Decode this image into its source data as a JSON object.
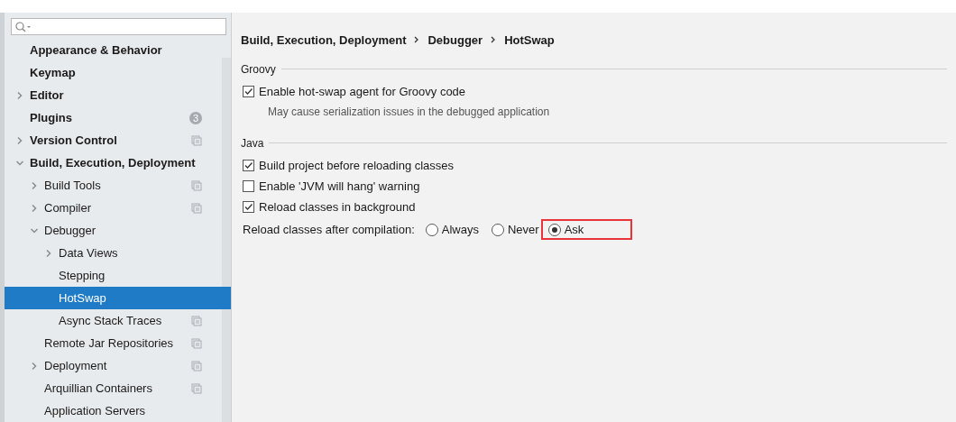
{
  "sidebar": {
    "items": [
      {
        "label": "Appearance & Behavior",
        "selected": false
      },
      {
        "label": "Keymap",
        "selected": false
      },
      {
        "label": "Editor",
        "expanded": false,
        "selected": false
      },
      {
        "label": "Plugins",
        "selected": false,
        "badge": "3"
      },
      {
        "label": "Version Control",
        "expanded": false,
        "selected": false,
        "project_icon": true
      },
      {
        "label": "Build, Execution, Deployment",
        "expanded": true,
        "selected": false,
        "children": [
          {
            "label": "Build Tools",
            "expanded": false,
            "selected": false,
            "project_icon": true
          },
          {
            "label": "Compiler",
            "expanded": false,
            "selected": false,
            "project_icon": true
          },
          {
            "label": "Debugger",
            "expanded": true,
            "selected": false,
            "children": [
              {
                "label": "Data Views",
                "expanded": false,
                "selected": false
              },
              {
                "label": "Stepping",
                "selected": false
              },
              {
                "label": "HotSwap",
                "selected": true
              },
              {
                "label": "Async Stack Traces",
                "selected": false,
                "project_icon": true
              }
            ]
          },
          {
            "label": "Remote Jar Repositories",
            "selected": false,
            "project_icon": true
          },
          {
            "label": "Deployment",
            "expanded": false,
            "selected": false,
            "project_icon": true
          },
          {
            "label": "Arquillian Containers",
            "selected": false,
            "project_icon": true
          },
          {
            "label": "Application Servers",
            "selected": false
          }
        ]
      }
    ]
  },
  "breadcrumb": [
    "Build, Execution, Deployment",
    "Debugger",
    "HotSwap"
  ],
  "sections": [
    {
      "title": "Groovy",
      "rows": [
        {
          "kind": "checkbox",
          "label": "Enable hot-swap agent for Groovy code",
          "checked": true
        },
        {
          "kind": "note",
          "label": "May cause serialization issues in the debugged application"
        }
      ]
    },
    {
      "title": "Java",
      "rows": [
        {
          "kind": "checkbox",
          "label": "Build project before reloading classes",
          "checked": true
        },
        {
          "kind": "checkbox",
          "label": "Enable 'JVM will hang' warning",
          "checked": false
        },
        {
          "kind": "checkbox",
          "label": "Reload classes in background",
          "checked": true
        },
        {
          "kind": "radio",
          "label": "Reload classes after compilation:",
          "options": [
            {
              "label": "Always",
              "selected": false
            },
            {
              "label": "Never",
              "selected": false
            },
            {
              "label": "Ask",
              "selected": true,
              "highlighted": true
            }
          ]
        }
      ]
    }
  ]
}
